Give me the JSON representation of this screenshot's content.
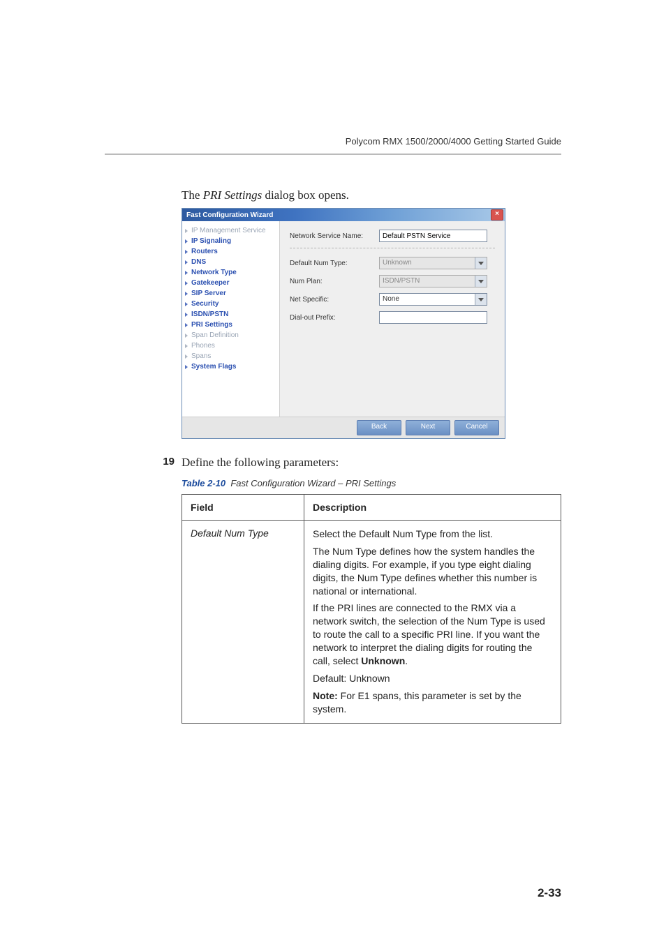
{
  "running_head": "Polycom RMX 1500/2000/4000 Getting Started Guide",
  "lead_text_prefix": "The ",
  "lead_text_italic": "PRI Settings",
  "lead_text_suffix": " dialog box opens.",
  "dialog": {
    "title": "Fast Configuration Wizard",
    "close_glyph": "×",
    "nav": [
      {
        "label": "IP Management Service",
        "state": "disabled"
      },
      {
        "label": "IP Signaling",
        "state": "bold"
      },
      {
        "label": "Routers",
        "state": "bold"
      },
      {
        "label": "DNS",
        "state": "bold"
      },
      {
        "label": "Network Type",
        "state": "bold"
      },
      {
        "label": "Gatekeeper",
        "state": "bold"
      },
      {
        "label": "SIP Server",
        "state": "bold"
      },
      {
        "label": "Security",
        "state": "bold"
      },
      {
        "label": "ISDN/PSTN",
        "state": "bold"
      },
      {
        "label": "PRI Settings",
        "state": "selected"
      },
      {
        "label": "Span Definition",
        "state": "disabled"
      },
      {
        "label": "Phones",
        "state": "disabled"
      },
      {
        "label": "Spans",
        "state": "disabled"
      },
      {
        "label": "System Flags",
        "state": "bold"
      }
    ],
    "form": {
      "network_service_name_label": "Network Service Name:",
      "network_service_name_value": "Default PSTN Service",
      "default_num_type_label": "Default Num Type:",
      "default_num_type_value": "Unknown",
      "num_plan_label": "Num Plan:",
      "num_plan_value": "ISDN/PSTN",
      "net_specific_label": "Net Specific:",
      "net_specific_value": "None",
      "dial_out_prefix_label": "Dial-out Prefix:",
      "dial_out_prefix_value": ""
    },
    "buttons": {
      "back": "Back",
      "next": "Next",
      "cancel": "Cancel"
    }
  },
  "step": {
    "num": "19",
    "text": "Define the following parameters:"
  },
  "table": {
    "cap_num": "Table 2-10",
    "cap_text": "Fast Configuration Wizard – PRI Settings",
    "head_field": "Field",
    "head_desc": "Description",
    "row1": {
      "field": "Default Num Type",
      "p1": "Select the Default Num Type from the list.",
      "p2": "The Num Type defines how the system handles the dialing digits. For example, if you type eight dialing digits, the Num Type defines whether this number is national or international.",
      "p3a": "If the PRI lines are connected to the RMX via a network switch, the selection of the Num Type is used to route the call to a specific PRI line. If you want the network to interpret the dialing digits for routing the call, select ",
      "p3b_bold": "Unknown",
      "p3c": ".",
      "p4": "Default: Unknown",
      "p5a_bold": "Note:",
      "p5b": " For E1 spans, this parameter is set by the system."
    }
  },
  "page_number": "2-33"
}
